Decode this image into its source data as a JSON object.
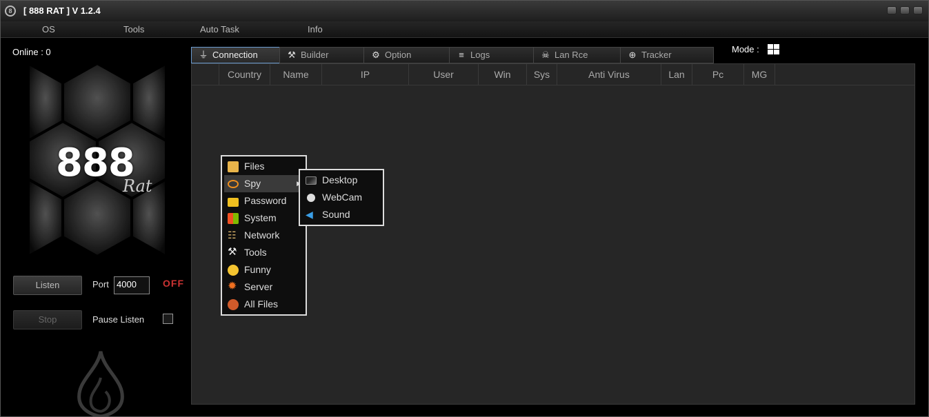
{
  "window": {
    "title": "[ 888 RAT ] V 1.2.4"
  },
  "menu": [
    "OS",
    "Tools",
    "Auto Task",
    "Info"
  ],
  "left": {
    "online_label": "Online : 0",
    "logo_main": "888",
    "logo_sub": "Rat",
    "listen_button": "Listen",
    "port_label": "Port",
    "port_value": "4000",
    "status": "OFF",
    "stop_button": "Stop",
    "pause_label": "Pause Listen"
  },
  "tabs": [
    {
      "label": "Connection",
      "icon": "plug-icon"
    },
    {
      "label": "Builder",
      "icon": "tools-icon"
    },
    {
      "label": "Option",
      "icon": "gear-icon"
    },
    {
      "label": "Logs",
      "icon": "database-icon"
    },
    {
      "label": "Lan Rce",
      "icon": "skull-icon"
    },
    {
      "label": "Tracker",
      "icon": "globe-icon"
    }
  ],
  "mode_label": "Mode :",
  "columns": [
    "Country",
    "Name",
    "IP",
    "User",
    "Win",
    "Sys",
    "Anti Virus",
    "Lan",
    "Pc",
    "MG"
  ],
  "context_menu": [
    {
      "label": "Files",
      "icon": "folder-icon",
      "color": "#e8b44a"
    },
    {
      "label": "Spy",
      "icon": "eye-icon",
      "color": "#f0901e"
    },
    {
      "label": "Password",
      "icon": "lock-icon",
      "color": "#f0c020"
    },
    {
      "label": "System",
      "icon": "windows-icon",
      "color": "#3a8ee6"
    },
    {
      "label": "Network",
      "icon": "network-icon",
      "color": "#d9b36a"
    },
    {
      "label": "Tools",
      "icon": "tools-icon",
      "color": "#eeeeee"
    },
    {
      "label": "Funny",
      "icon": "smiley-icon",
      "color": "#f4c430"
    },
    {
      "label": "Server",
      "icon": "sun-icon",
      "color": "#f07020"
    },
    {
      "label": "All Files",
      "icon": "download-icon",
      "color": "#d05a2a"
    }
  ],
  "submenu": [
    {
      "label": "Desktop",
      "icon": "monitor-icon"
    },
    {
      "label": "WebCam",
      "icon": "webcam-icon"
    },
    {
      "label": "Sound",
      "icon": "speaker-icon"
    }
  ]
}
